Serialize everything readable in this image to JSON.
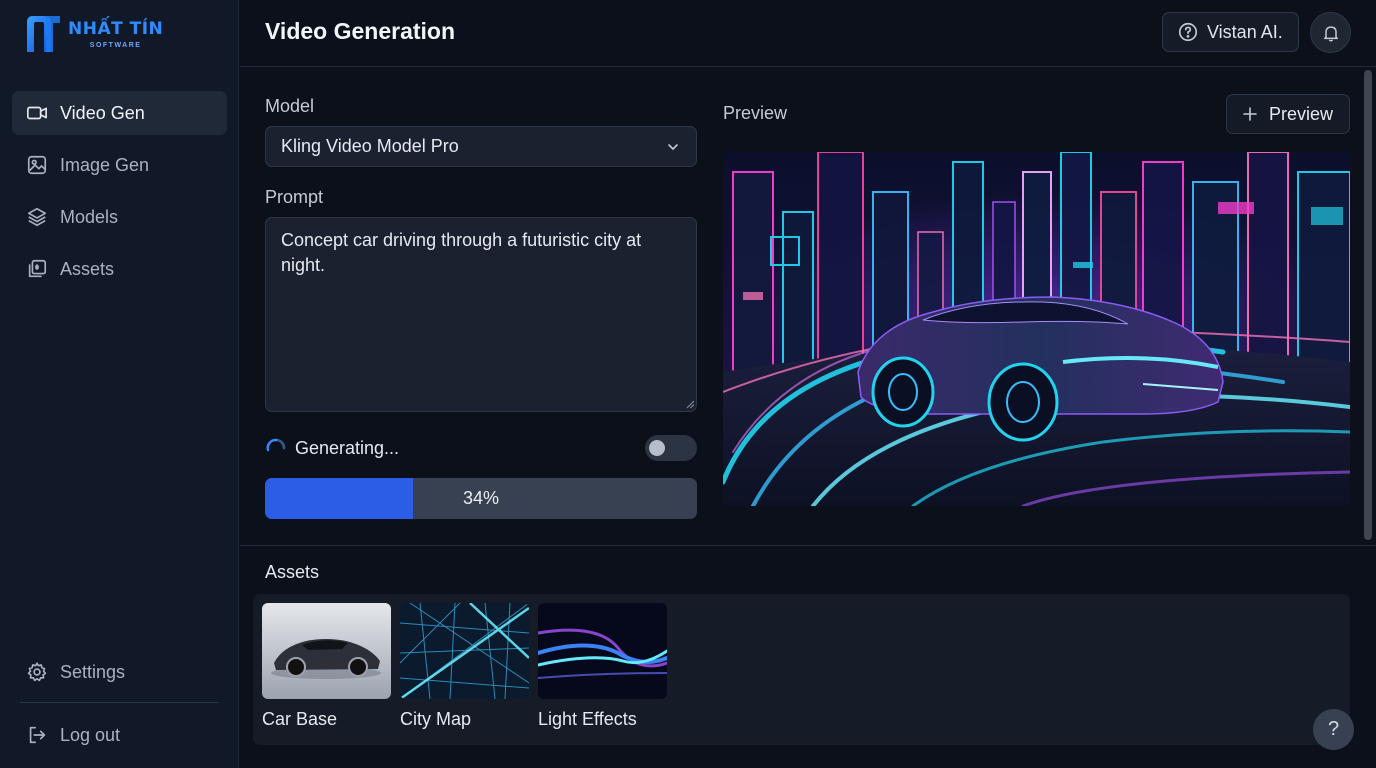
{
  "brand": {
    "name": "NHẤT TÍN",
    "tagline": "SOFTWARE",
    "color": "#1f7cf2"
  },
  "sidebar": {
    "items": [
      {
        "label": "Video Gen",
        "icon": "video-camera-icon",
        "active": true
      },
      {
        "label": "Image Gen",
        "icon": "image-icon",
        "active": false
      },
      {
        "label": "Models",
        "icon": "layers-icon",
        "active": false
      },
      {
        "label": "Assets",
        "icon": "assets-icon",
        "active": false
      }
    ],
    "settings_label": "Settings",
    "logout_label": "Log out"
  },
  "header": {
    "title": "Video Generation",
    "user_label": "Vistan AI."
  },
  "form": {
    "model_label": "Model",
    "model_value": "Kling Video Model Pro",
    "prompt_label": "Prompt",
    "prompt_value": "Concept car driving through a futuristic city at night.",
    "status_text": "Generating...",
    "toggle_on": false,
    "progress": 34,
    "progress_text": "34%"
  },
  "preview": {
    "label": "Preview",
    "button_label": "Preview"
  },
  "assets": {
    "title": "Assets",
    "items": [
      {
        "name": "Car Base"
      },
      {
        "name": "City Map"
      },
      {
        "name": "Light Effects"
      }
    ]
  },
  "help_label": "?",
  "colors": {
    "accent": "#2b5de6",
    "background": "#0b101a",
    "sidebar": "#111827"
  }
}
